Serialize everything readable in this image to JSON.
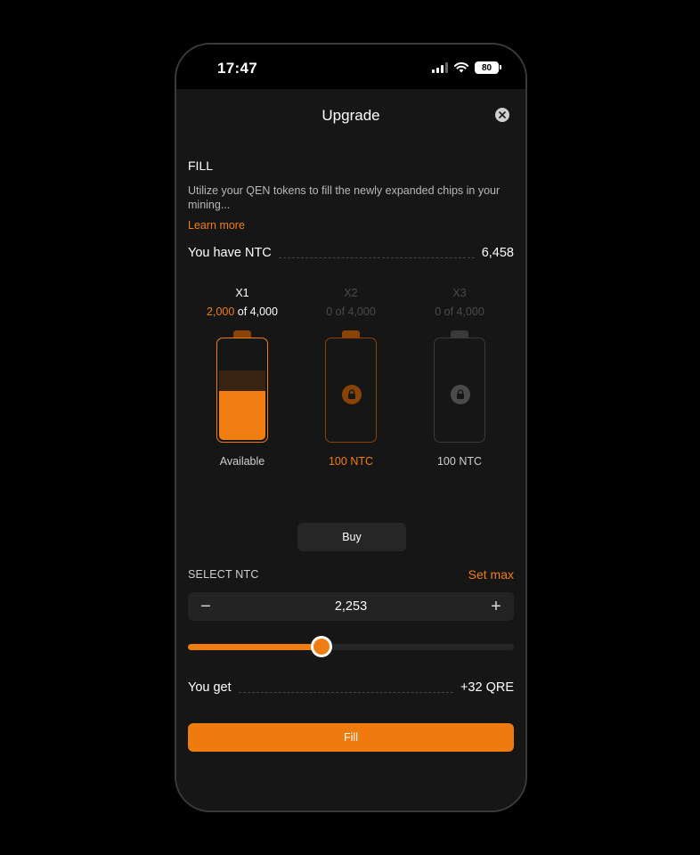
{
  "status": {
    "time": "17:47",
    "battery": "80",
    "icons": [
      "signal-icon",
      "wifi-icon",
      "battery-icon"
    ]
  },
  "header": {
    "title": "Upgrade",
    "close_icon": "close-icon"
  },
  "fill": {
    "section_label": "FILL",
    "description": "Utilize your QEN tokens to fill the newly expanded chips in your mining...",
    "learn_more": "Learn more",
    "balance_label": "You have NTC",
    "balance_value": "6,458"
  },
  "chips": [
    {
      "multiplier": "X1",
      "filled": "2,000",
      "of_text": "of 4,000",
      "count_text": "",
      "level": 0.5,
      "caption": "Available",
      "state": "active"
    },
    {
      "multiplier": "X2",
      "count_text": "0 of 4,000",
      "caption": "100 NTC",
      "state": "locked-orange"
    },
    {
      "multiplier": "X3",
      "count_text": "0 of 4,000",
      "caption": "100 NTC",
      "state": "locked-gray"
    }
  ],
  "buy": {
    "label": "Buy"
  },
  "select": {
    "label": "SELECT NTC",
    "set_max": "Set max",
    "value": "2,253",
    "minus": "−",
    "plus": "+",
    "slider_fraction": 0.41
  },
  "result": {
    "label": "You get",
    "value": "+32 QRE"
  },
  "action": {
    "fill_label": "Fill"
  },
  "colors": {
    "accent": "#f07d12",
    "background": "#161616",
    "surface": "#232323"
  }
}
